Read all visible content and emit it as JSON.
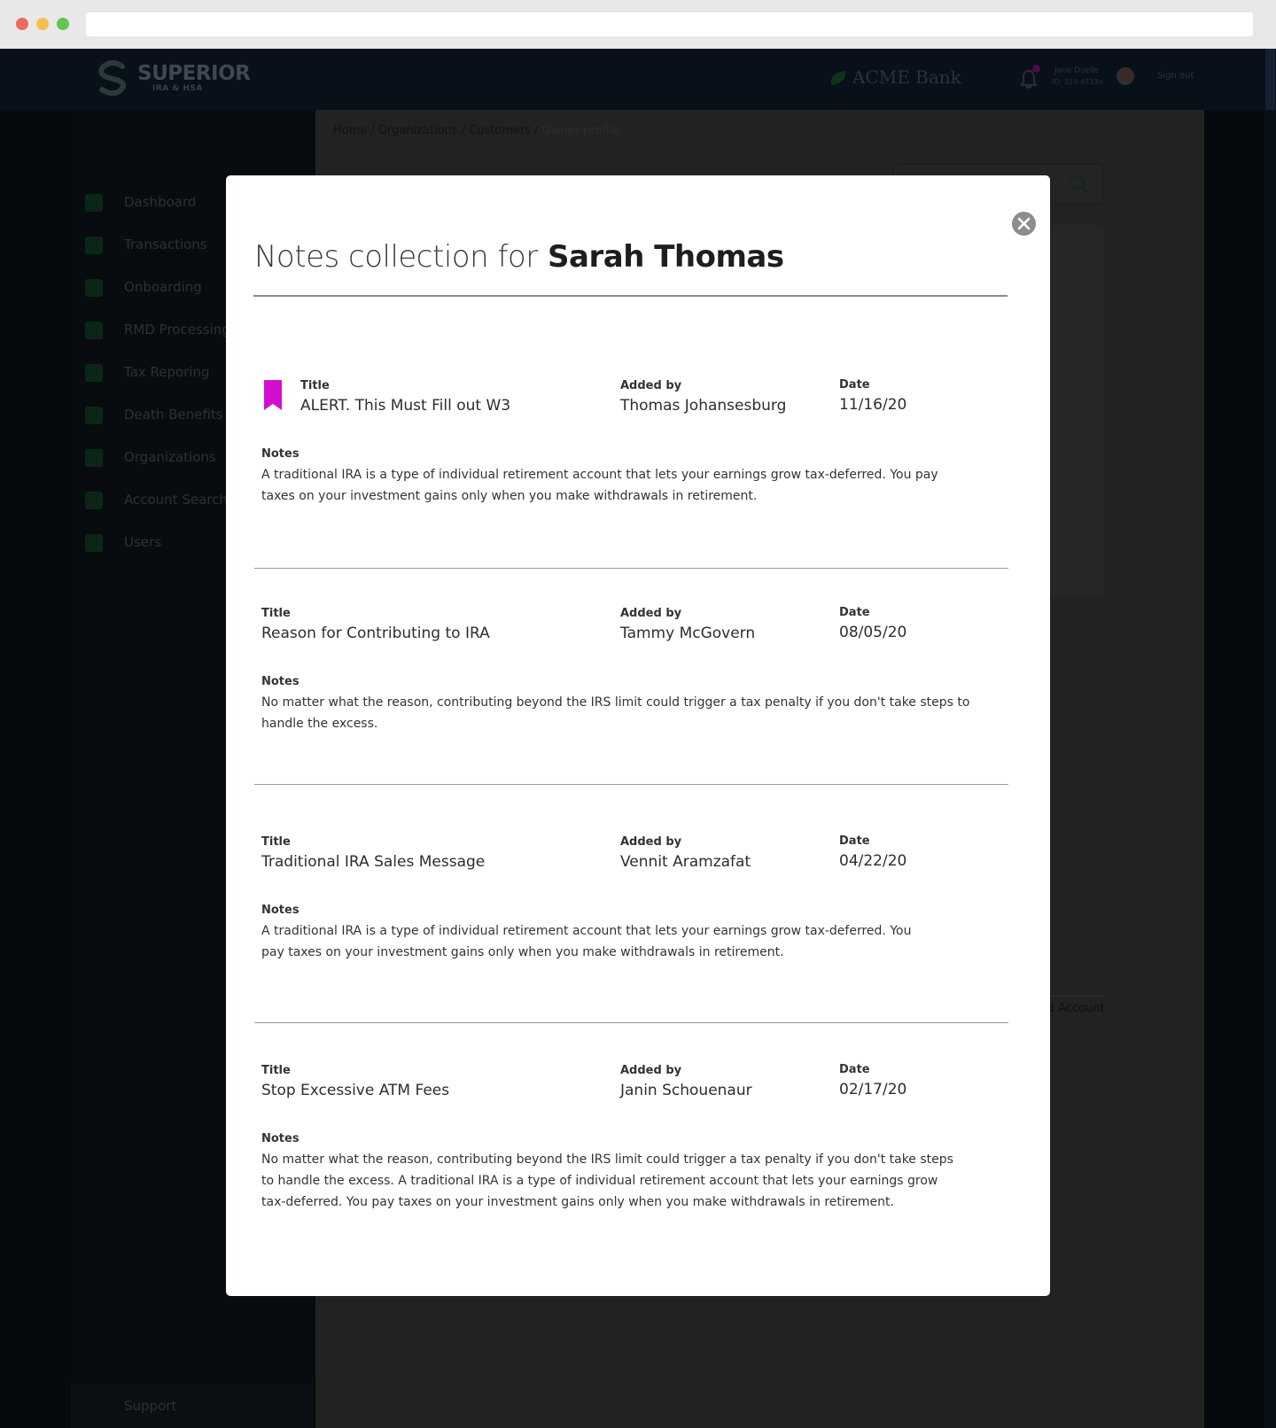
{
  "app": {
    "logo_name": "SUPERIOR",
    "logo_sub": "IRA & HSA",
    "bank_name": "ACME Bank",
    "user": {
      "name": "Jane Doelle",
      "id": "ID: 324-4733n"
    },
    "sign_out": "Sign out"
  },
  "sidebar": {
    "items": [
      {
        "label": "Dashboard",
        "icon": "dashboard-icon"
      },
      {
        "label": "Transactions",
        "icon": "transfer-arrows-icon"
      },
      {
        "label": "Onboarding",
        "icon": "bank-icon"
      },
      {
        "label": "RMD Processing",
        "icon": "calendar-icon"
      },
      {
        "label": "Tax Reporing",
        "icon": "trend-icon"
      },
      {
        "label": "Death Benefits",
        "icon": "hands-icon"
      },
      {
        "label": "Organizations",
        "icon": "gears-icon"
      },
      {
        "label": "Account Search",
        "icon": "document-search-icon"
      },
      {
        "label": "Users",
        "icon": "user-icon"
      }
    ],
    "support": "Support"
  },
  "breadcrumb": {
    "items": [
      "Home",
      "Organizations",
      "Customers"
    ],
    "current": "Owner profile",
    "separator": "/"
  },
  "background": {
    "account_link": "ld Account"
  },
  "modal": {
    "title_prefix": "Notes collection for",
    "customer_name": "Sarah Thomas",
    "labels": {
      "title": "Title",
      "added_by": "Added by",
      "date": "Date",
      "notes": "Notes"
    },
    "notes": [
      {
        "bookmarked": true,
        "title": "ALERT. This Must Fill out W3",
        "added_by": "Thomas Johansesburg",
        "date": "11/16/20",
        "notes": "A traditional IRA is a type of individual retirement account that lets your earnings grow tax-deferred. You pay taxes on your investment gains only when you make withdrawals in retirement."
      },
      {
        "bookmarked": false,
        "title": "Reason for Contributing to IRA",
        "added_by": "Tammy McGovern",
        "date": "08/05/20",
        "notes": "No matter what the reason, contributing beyond the IRS limit could trigger a tax penalty if you don't take steps to handle the excess."
      },
      {
        "bookmarked": false,
        "title": "Traditional IRA Sales Message",
        "added_by": "Vennit Aramzafat",
        "date": "04/22/20",
        "notes": "A traditional IRA is a type of individual retirement account that lets your earnings grow tax-deferred. You pay taxes on your investment gains only when you make withdrawals in retirement."
      },
      {
        "bookmarked": false,
        "title": "Stop Excessive ATM Fees",
        "added_by": "Janin Schouenaur",
        "date": "02/17/20",
        "notes": "No matter what the reason, contributing beyond the IRS limit could trigger a tax penalty if you don't take steps to handle the excess. A traditional IRA is a type of individual retirement account that lets your earnings grow tax-deferred. You pay taxes on your investment gains only when you make withdrawals in retirement."
      }
    ]
  },
  "colors": {
    "bookmark": "#d20fcf",
    "overlay": "#06090e",
    "close_button": "#8d8d8d"
  }
}
